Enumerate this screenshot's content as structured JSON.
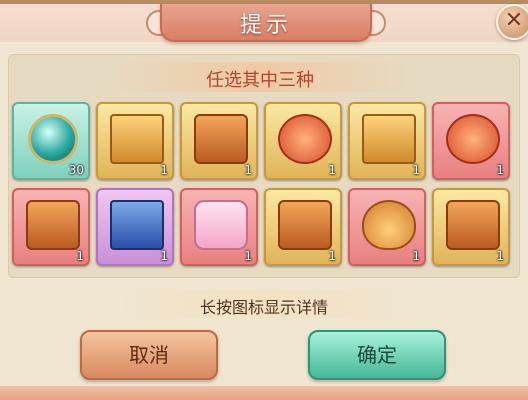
{
  "dialog": {
    "title": "提示",
    "close_icon": "close-icon",
    "subtitle": "任选其中三种",
    "hint": "长按图标显示详情",
    "buttons": {
      "cancel": "取消",
      "confirm": "确定"
    }
  },
  "items": [
    {
      "name": "teal-orb",
      "count": "30",
      "frame": "teal"
    },
    {
      "name": "golden-box-with-dice",
      "count": "1",
      "frame": "gold"
    },
    {
      "name": "treasure-chest-with-character",
      "count": "1",
      "frame": "gold"
    },
    {
      "name": "open-red-chest",
      "count": "1",
      "frame": "gold"
    },
    {
      "name": "orange-box",
      "count": "1",
      "frame": "gold"
    },
    {
      "name": "red-pouch",
      "count": "1",
      "frame": "red"
    },
    {
      "name": "red-octagonal-box",
      "count": "1",
      "frame": "red"
    },
    {
      "name": "blue-box-with-dice",
      "count": "1",
      "frame": "purple"
    },
    {
      "name": "pink-cake-box",
      "count": "1",
      "frame": "red"
    },
    {
      "name": "ornate-golden-chest",
      "count": "1",
      "frame": "gold"
    },
    {
      "name": "gold-coin-bag",
      "count": "1",
      "frame": "red"
    },
    {
      "name": "floral-treasure-chest",
      "count": "1",
      "frame": "gold"
    }
  ]
}
